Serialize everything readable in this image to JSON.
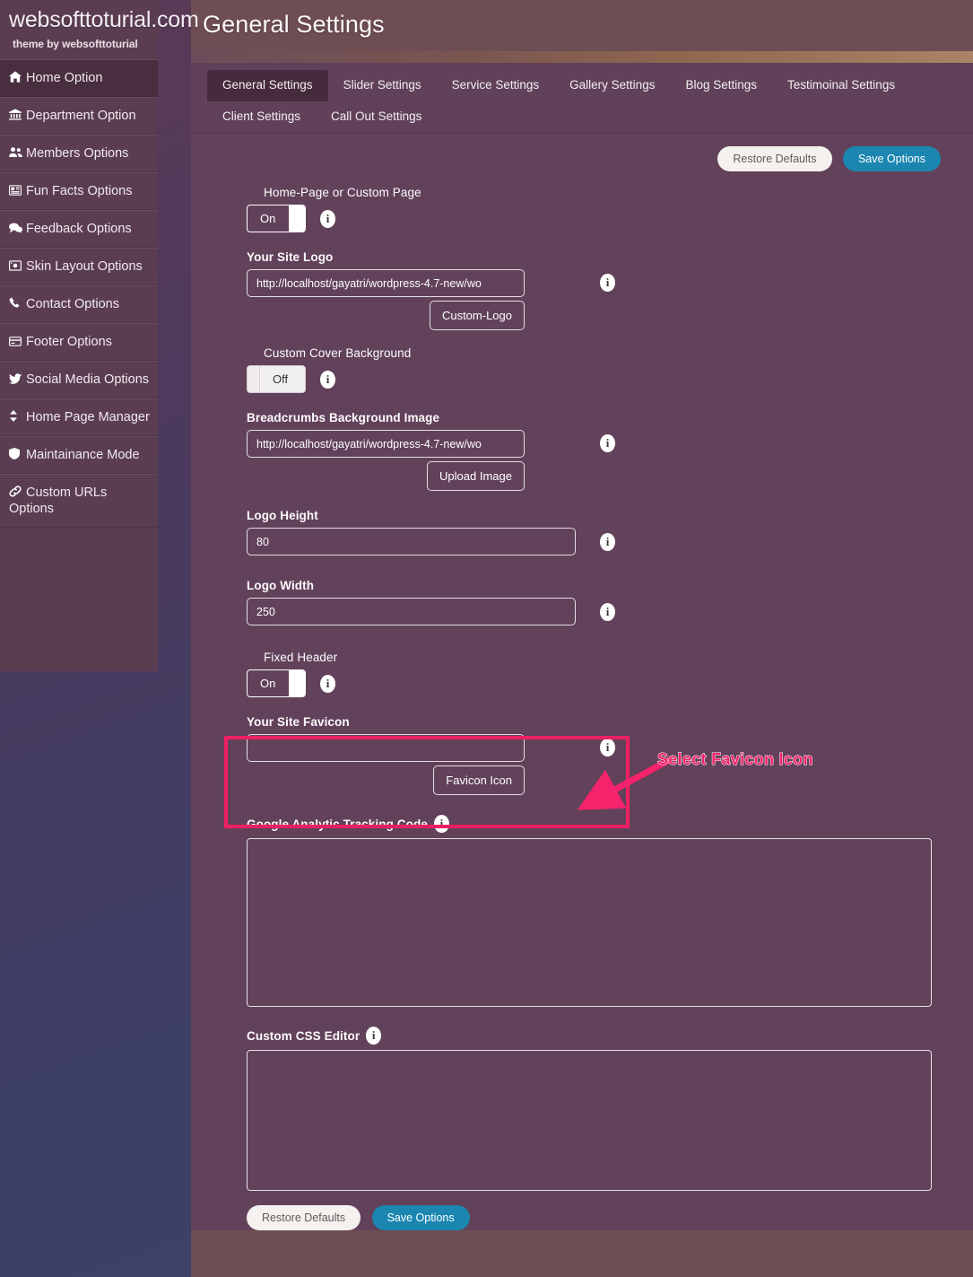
{
  "sidebar": {
    "site_title": "websofttoturial.com",
    "site_subtitle": "theme by websofttoturial",
    "items": [
      {
        "label": "Home Option",
        "icon": "home-icon",
        "active": true
      },
      {
        "label": "Department Option",
        "icon": "bank-icon",
        "active": false
      },
      {
        "label": "Members Options",
        "icon": "users-icon",
        "active": false
      },
      {
        "label": "Fun Facts Options",
        "icon": "newspaper-icon",
        "active": false
      },
      {
        "label": "Feedback Options",
        "icon": "comments-icon",
        "active": false
      },
      {
        "label": "Skin Layout Options",
        "icon": "image-icon",
        "active": false
      },
      {
        "label": "Contact Options",
        "icon": "phone-icon",
        "active": false
      },
      {
        "label": "Footer Options",
        "icon": "credit-card-icon",
        "active": false
      },
      {
        "label": "Social Media Options",
        "icon": "twitter-icon",
        "active": false
      },
      {
        "label": "Home Page Manager",
        "icon": "sort-icon",
        "active": false
      },
      {
        "label": "Maintainance Mode",
        "icon": "shield-icon",
        "active": false
      },
      {
        "label": "Custom URLs Options",
        "icon": "link-icon",
        "active": false
      }
    ]
  },
  "header": {
    "title": "General Settings"
  },
  "tabs": [
    {
      "label": "General Settings",
      "active": true
    },
    {
      "label": "Slider Settings",
      "active": false
    },
    {
      "label": "Service Settings",
      "active": false
    },
    {
      "label": "Gallery Settings",
      "active": false
    },
    {
      "label": "Blog Settings",
      "active": false
    },
    {
      "label": "Testimoinal Settings",
      "active": false
    },
    {
      "label": "Client Settings",
      "active": false
    },
    {
      "label": "Call Out Settings",
      "active": false
    }
  ],
  "toolbar": {
    "restore_label": "Restore Defaults",
    "save_label": "Save Options"
  },
  "fields": {
    "home_page": {
      "label": "Home-Page or Custom Page",
      "toggle_state": "On"
    },
    "site_logo": {
      "label": "Your Site Logo",
      "value": "http://localhost/gayatri/wordpress-4.7-new/wo",
      "button": "Custom-Logo"
    },
    "cover_bg": {
      "label": "Custom Cover Background",
      "toggle_state": "Off"
    },
    "breadcrumbs_bg": {
      "label": "Breadcrumbs Background Image",
      "value": "http://localhost/gayatri/wordpress-4.7-new/wo",
      "button": "Upload Image"
    },
    "logo_height": {
      "label": "Logo Height",
      "value": "80"
    },
    "logo_width": {
      "label": "Logo Width",
      "value": "250"
    },
    "fixed_header": {
      "label": "Fixed Header",
      "toggle_state": "On"
    },
    "favicon": {
      "label": "Your Site Favicon",
      "value": "",
      "button": "Favicon Icon"
    },
    "analytics": {
      "label": "Google Analytic Tracking Code",
      "value": ""
    },
    "custom_css": {
      "label": "Custom CSS Editor",
      "value": ""
    }
  },
  "footer_buttons": {
    "restore_label": "Restore Defaults",
    "save_label": "Save Options"
  },
  "annotation": {
    "text": "Select Favicon Icon",
    "color": "#f4236b",
    "box_color": "#ee1f63"
  },
  "colors": {
    "sidebar_bg": "#5b3d52",
    "panel_bg": "#62425a",
    "main_bg": "#6e4e54",
    "save_button": "#1b86b0",
    "accent_bar_end": "#ab8468"
  }
}
